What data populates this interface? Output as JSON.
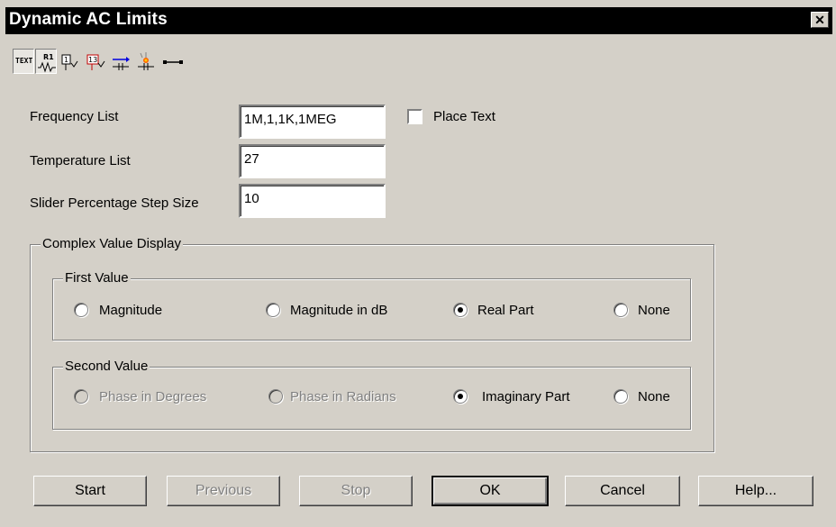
{
  "window": {
    "title": "Dynamic AC Limits",
    "close_glyph": "✕"
  },
  "toolbar": {
    "text_button_label": "TEXT",
    "icons": [
      "text-toggle-icon",
      "resistor-label-icon",
      "node-number-icon",
      "node-voltage-icon",
      "current-flow-icon",
      "power-dissipation-icon",
      "pin-connection-icon"
    ]
  },
  "fields": {
    "frequency_label": "Frequency List",
    "frequency_value": "1M,1,1K,1MEG",
    "place_text_label": "Place Text",
    "place_text_checked": false,
    "temperature_label": "Temperature List",
    "temperature_value": "27",
    "slider_label": "Slider Percentage Step Size",
    "slider_value": "10"
  },
  "complex": {
    "legend": "Complex Value Display",
    "first": {
      "legend": "First Value",
      "options": [
        "Magnitude",
        "Magnitude in dB",
        "Real Part",
        "None"
      ],
      "selected": "Real Part"
    },
    "second": {
      "legend": "Second Value",
      "options": [
        "Phase in Degrees",
        "Phase in Radians",
        "Imaginary Part",
        "None"
      ],
      "selected": "Imaginary Part",
      "disabled": [
        "Phase in Degrees",
        "Phase in Radians"
      ]
    }
  },
  "buttons": {
    "start": "Start",
    "previous": "Previous",
    "stop": "Stop",
    "ok": "OK",
    "cancel": "Cancel",
    "help": "Help..."
  }
}
